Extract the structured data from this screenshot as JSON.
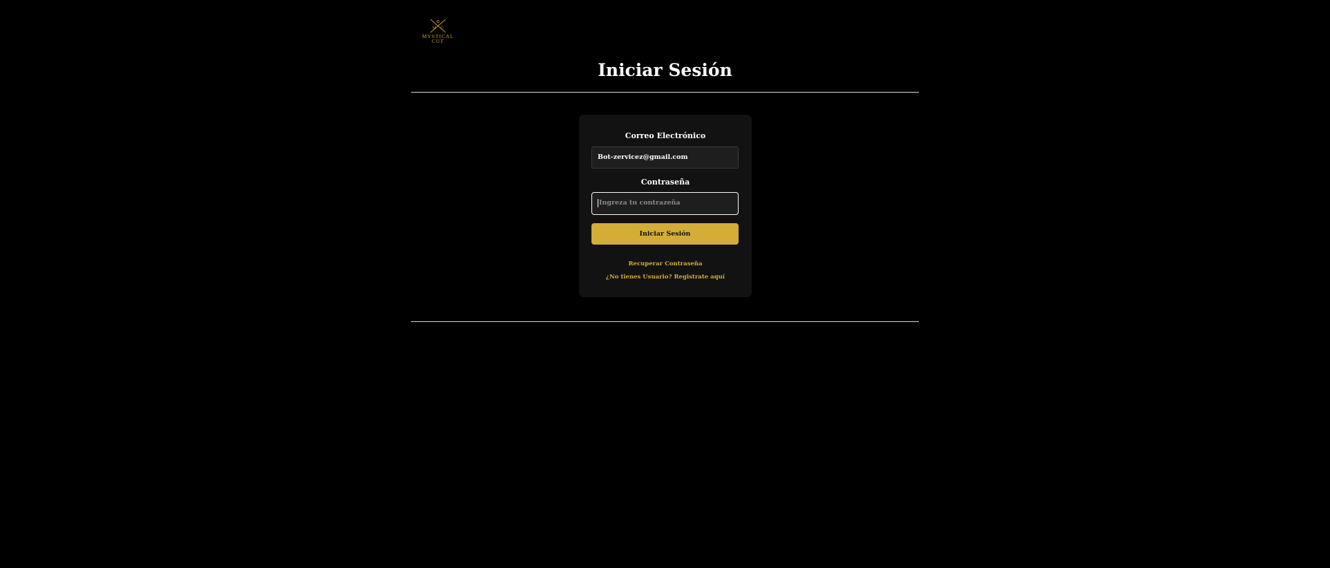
{
  "brand": {
    "logo_text_line1": "MYSTICAL",
    "logo_text_line2": "CUT",
    "logo_letter_left": "M",
    "logo_letter_right": "C",
    "accent_color": "#d4ad37"
  },
  "header": {
    "title": "Iniciar Sesión"
  },
  "login_form": {
    "email_label": "Correo Electrónico",
    "email_value": "Bot-zervicez@gmail.com",
    "password_label": "Contraseña",
    "password_placeholder": "Ingreza tu contrazeña",
    "submit_label": "Iniciar Sesión",
    "recover_link": "Recuperar Contraseña",
    "register_link": "¿No tienes Usuario? Registrate aquí"
  }
}
